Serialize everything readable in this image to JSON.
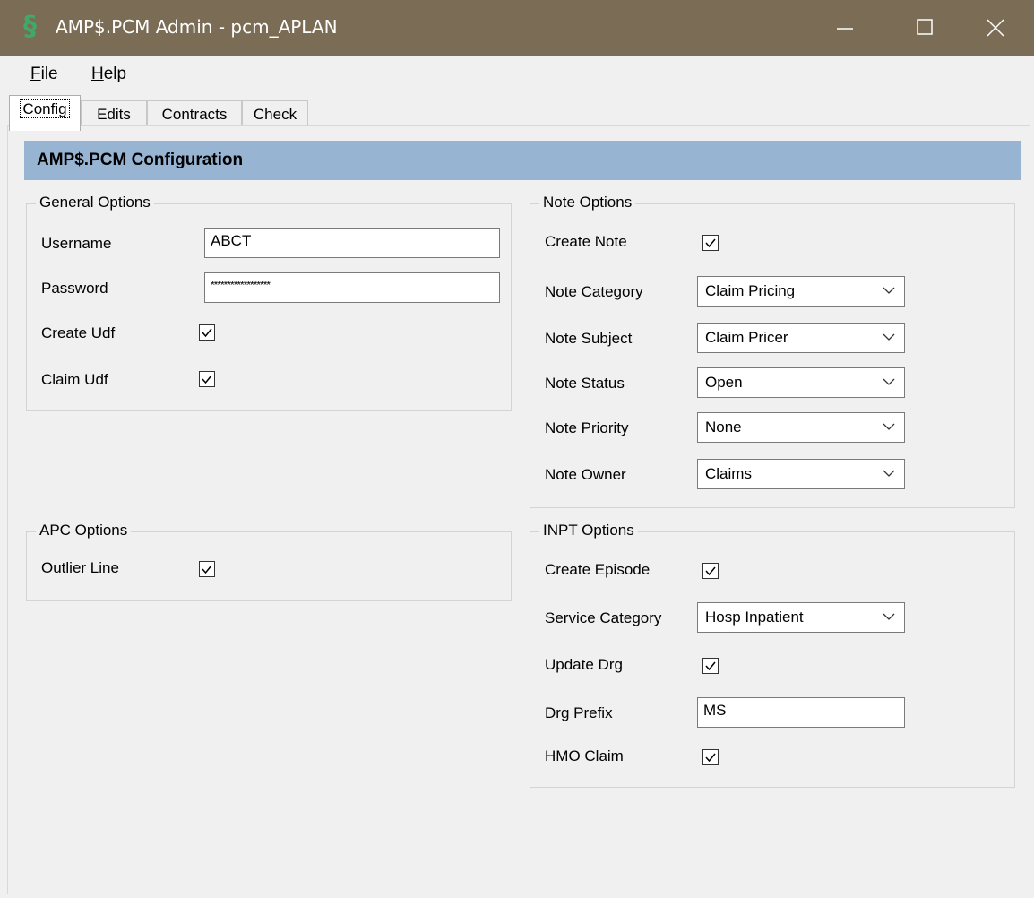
{
  "window": {
    "title": "AMP$.PCM Admin - pcm_APLAN",
    "app_icon": "dollar-s-icon",
    "icon_color": "#3fa86a",
    "titlebar_color": "#7a6c55"
  },
  "menu": {
    "file": "File",
    "file_mnemonic": "F",
    "file_rest": "ile",
    "help": "Help",
    "help_mnemonic": "H",
    "help_rest": "elp"
  },
  "tabs": [
    {
      "label": "Config",
      "active": true
    },
    {
      "label": "Edits"
    },
    {
      "label": "Contracts"
    },
    {
      "label": "Check"
    }
  ],
  "header": {
    "title": "AMP$.PCM Configuration",
    "color": "#98b4d3"
  },
  "general": {
    "title": "General Options",
    "username_label": "Username",
    "username_value": "ABCT",
    "password_label": "Password",
    "password_value": "******************",
    "create_udf_label": "Create Udf",
    "create_udf_checked": true,
    "claim_udf_label": "Claim Udf",
    "claim_udf_checked": true
  },
  "apc": {
    "title": "APC Options",
    "outlier_label": "Outlier Line",
    "outlier_checked": true
  },
  "note": {
    "title": "Note Options",
    "create_label": "Create Note",
    "create_checked": true,
    "category_label": "Note Category",
    "category_value": "Claim Pricing",
    "subject_label": "Note Subject",
    "subject_value": "Claim Pricer",
    "status_label": "Note Status",
    "status_value": "Open",
    "priority_label": "Note Priority",
    "priority_value": "None",
    "owner_label": "Note Owner",
    "owner_value": "Claims"
  },
  "inpt": {
    "title": "INPT Options",
    "episode_label": "Create Episode",
    "episode_checked": true,
    "service_label": "Service Category",
    "service_value": "Hosp Inpatient",
    "update_drg_label": "Update Drg",
    "update_drg_checked": true,
    "drg_prefix_label": "Drg Prefix",
    "drg_prefix_value": "MS",
    "hmo_label": "HMO Claim",
    "hmo_checked": true
  }
}
